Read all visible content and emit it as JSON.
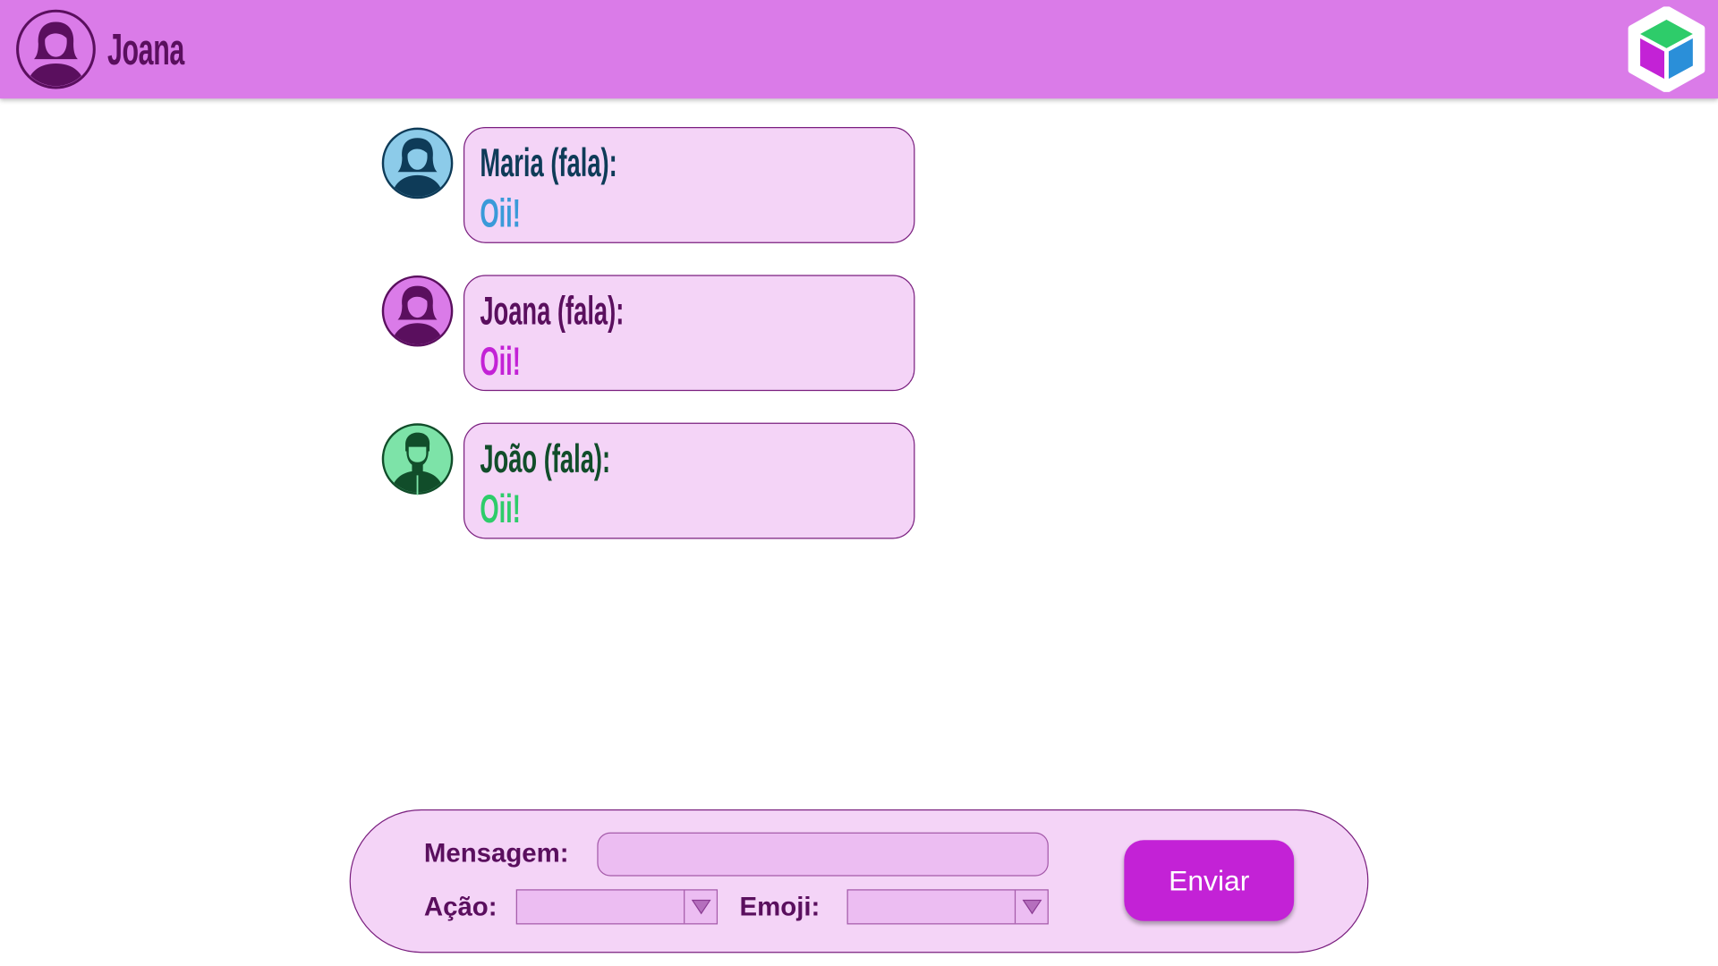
{
  "header": {
    "user_name": "Joana",
    "avatar_icon": "woman-avatar-icon",
    "logo_icon": "cube-logo-icon",
    "background_color": "#da7be8"
  },
  "messages": [
    {
      "author_label": "Maria (fala):",
      "text": "Oii!",
      "avatar_icon": "woman-avatar-icon",
      "author_color": "#0e3b58",
      "text_color": "#3a9ad9",
      "avatar_bg": "#8ccbe9"
    },
    {
      "author_label": "Joana (fala):",
      "text": "Oii!",
      "avatar_icon": "woman-avatar-icon",
      "author_color": "#5a0f5e",
      "text_color": "#c322d6",
      "avatar_bg": "#da7be8"
    },
    {
      "author_label": "João (fala):",
      "text": "Oii!",
      "avatar_icon": "man-avatar-icon",
      "author_color": "#114d2a",
      "text_color": "#2ecc6a",
      "avatar_bg": "#7de3a8"
    }
  ],
  "composer": {
    "message_label": "Mensagem:",
    "message_value": "",
    "action_label": "Ação:",
    "action_value": "",
    "emoji_label": "Emoji:",
    "emoji_value": "",
    "send_label": "Enviar"
  }
}
